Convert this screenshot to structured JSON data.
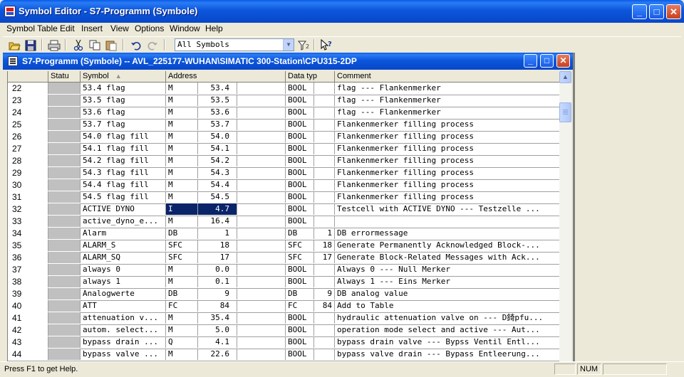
{
  "window": {
    "title": "Symbol Editor - S7-Programm (Symbole)",
    "minimize_glyph": "_",
    "maximize_glyph": "□",
    "close_glyph": "✕"
  },
  "menu": [
    "Symbol Table",
    "Edit",
    "Insert",
    "View",
    "Options",
    "Window",
    "Help"
  ],
  "toolbar": {
    "filter_value": "All Symbols",
    "icons": [
      "open-icon",
      "save-icon",
      "print-icon",
      "cut-icon",
      "copy-icon",
      "paste-icon",
      "undo-icon",
      "redo-icon",
      "filter-icon",
      "help-pointer-icon"
    ]
  },
  "child": {
    "title": "S7-Programm (Symbole) -- AVL_225177-WUHAN\\SIMATIC 300-Station\\CPU315-2DP"
  },
  "columns": [
    "",
    "Statu",
    "Symbol",
    "Address",
    "Data typ",
    "Comment"
  ],
  "rows": [
    {
      "n": "22",
      "sym": "53.4 flag",
      "a1": "M",
      "a2": "53.4",
      "dt1": "BOOL",
      "dt2": "",
      "com": "flag --- Flankenmerker"
    },
    {
      "n": "23",
      "sym": "53.5 flag",
      "a1": "M",
      "a2": "53.5",
      "dt1": "BOOL",
      "dt2": "",
      "com": "flag --- Flankenmerker"
    },
    {
      "n": "24",
      "sym": "53.6 flag",
      "a1": "M",
      "a2": "53.6",
      "dt1": "BOOL",
      "dt2": "",
      "com": "flag --- Flankenmerker"
    },
    {
      "n": "25",
      "sym": "53.7 flag",
      "a1": "M",
      "a2": "53.7",
      "dt1": "BOOL",
      "dt2": "",
      "com": "Flankenmerker filling process"
    },
    {
      "n": "26",
      "sym": "54.0 flag fill",
      "a1": "M",
      "a2": "54.0",
      "dt1": "BOOL",
      "dt2": "",
      "com": "Flankenmerker filling process"
    },
    {
      "n": "27",
      "sym": "54.1 flag fill",
      "a1": "M",
      "a2": "54.1",
      "dt1": "BOOL",
      "dt2": "",
      "com": "Flankenmerker filling process"
    },
    {
      "n": "28",
      "sym": "54.2 flag fill",
      "a1": "M",
      "a2": "54.2",
      "dt1": "BOOL",
      "dt2": "",
      "com": "Flankenmerker filling process"
    },
    {
      "n": "29",
      "sym": "54.3 flag fill",
      "a1": "M",
      "a2": "54.3",
      "dt1": "BOOL",
      "dt2": "",
      "com": "Flankenmerker filling process"
    },
    {
      "n": "30",
      "sym": "54.4 flag fill",
      "a1": "M",
      "a2": "54.4",
      "dt1": "BOOL",
      "dt2": "",
      "com": "Flankenmerker filling process"
    },
    {
      "n": "31",
      "sym": "54.5 flag fill",
      "a1": "M",
      "a2": "54.5",
      "dt1": "BOOL",
      "dt2": "",
      "com": "Flankenmerker filling process"
    },
    {
      "n": "32",
      "sym": "ACTIVE DYNO",
      "a1": "I",
      "a2": "4.7",
      "dt1": "BOOL",
      "dt2": "",
      "com": "Testcell with ACTIVE DYNO --- Testzelle ...",
      "sel": true
    },
    {
      "n": "33",
      "sym": "active_dyno_e...",
      "a1": "M",
      "a2": "16.4",
      "dt1": "BOOL",
      "dt2": "",
      "com": ""
    },
    {
      "n": "34",
      "sym": "Alarm",
      "a1": "DB",
      "a2": "1",
      "dt1": "DB",
      "dt2": "1",
      "com": "DB errormessage"
    },
    {
      "n": "35",
      "sym": "ALARM_S",
      "a1": "SFC",
      "a2": "18",
      "dt1": "SFC",
      "dt2": "18",
      "com": "Generate Permanently Acknowledged Block-..."
    },
    {
      "n": "36",
      "sym": "ALARM_SQ",
      "a1": "SFC",
      "a2": "17",
      "dt1": "SFC",
      "dt2": "17",
      "com": "Generate Block-Related Messages with Ack..."
    },
    {
      "n": "37",
      "sym": "always 0",
      "a1": "M",
      "a2": "0.0",
      "dt1": "BOOL",
      "dt2": "",
      "com": "Always 0 --- Null Merker"
    },
    {
      "n": "38",
      "sym": "always 1",
      "a1": "M",
      "a2": "0.1",
      "dt1": "BOOL",
      "dt2": "",
      "com": "Always 1 --- Eins Merker"
    },
    {
      "n": "39",
      "sym": "Analogwerte",
      "a1": "DB",
      "a2": "9",
      "dt1": "DB",
      "dt2": "9",
      "com": "DB analog value"
    },
    {
      "n": "40",
      "sym": "ATT",
      "a1": "FC",
      "a2": "84",
      "dt1": "FC",
      "dt2": "84",
      "com": "Add to Table"
    },
    {
      "n": "41",
      "sym": "attenuation v...",
      "a1": "M",
      "a2": "35.4",
      "dt1": "BOOL",
      "dt2": "",
      "com": "hydraulic attenuation valve on --- D錡pfu..."
    },
    {
      "n": "42",
      "sym": "autom. select...",
      "a1": "M",
      "a2": "5.0",
      "dt1": "BOOL",
      "dt2": "",
      "com": "operation mode select and active --- Aut..."
    },
    {
      "n": "43",
      "sym": "bypass drain ...",
      "a1": "Q",
      "a2": "4.1",
      "dt1": "BOOL",
      "dt2": "",
      "com": "bypass drain valve --- Bypss Ventil Entl..."
    },
    {
      "n": "44",
      "sym": "bypass valve ...",
      "a1": "M",
      "a2": "22.6",
      "dt1": "BOOL",
      "dt2": "",
      "com": "bypass valve drain --- Bypass Entleerung..."
    }
  ],
  "status": {
    "help_text": "Press F1 to get Help.",
    "num": "NUM"
  }
}
